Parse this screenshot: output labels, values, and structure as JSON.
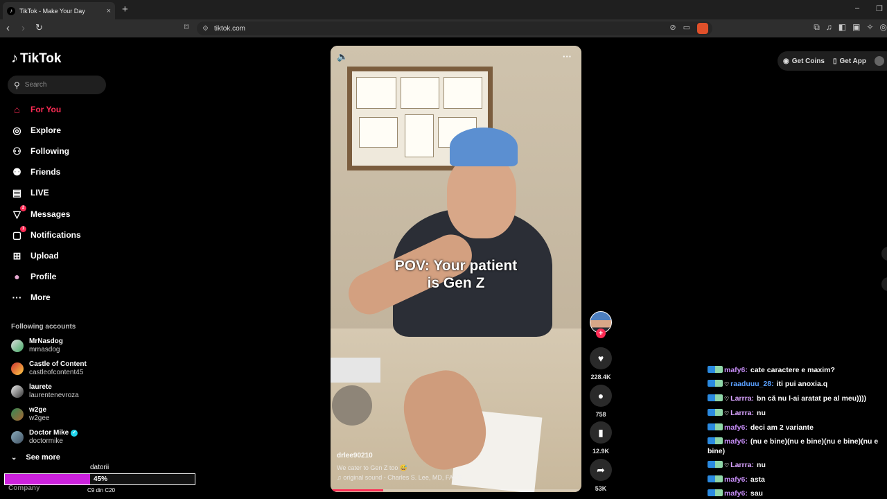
{
  "browser": {
    "tab_title": "TikTok - Make Your Day",
    "tab_close": "×",
    "new_tab": "+",
    "url": "tiktok.com",
    "window_min": "–",
    "window_max": "❐"
  },
  "sidebar": {
    "logo_text": "TikTok",
    "search_placeholder": "Search",
    "nav": [
      {
        "label": "For You",
        "icon": "home-icon"
      },
      {
        "label": "Explore",
        "icon": "compass-icon"
      },
      {
        "label": "Following",
        "icon": "following-icon"
      },
      {
        "label": "Friends",
        "icon": "friends-icon"
      },
      {
        "label": "LIVE",
        "icon": "live-icon"
      },
      {
        "label": "Messages",
        "icon": "messages-icon",
        "badge": "2"
      },
      {
        "label": "Notifications",
        "icon": "notifications-icon",
        "badge": "1"
      },
      {
        "label": "Upload",
        "icon": "upload-icon"
      },
      {
        "label": "Profile",
        "icon": "profile-icon"
      },
      {
        "label": "More",
        "icon": "more-icon"
      }
    ],
    "following_title": "Following accounts",
    "accounts": [
      {
        "name": "MrNasdog",
        "user": "mrnasdog"
      },
      {
        "name": "Castle of Content",
        "user": "castleofcontent45"
      },
      {
        "name": "laurete",
        "user": "laurentenevroza"
      },
      {
        "name": "w2ge",
        "user": "w2gee"
      },
      {
        "name": "Doctor Mike",
        "user": "doctormike",
        "verified": true
      }
    ],
    "see_more": "See more",
    "company": "Company"
  },
  "overlay": {
    "label": "datorii",
    "percent_text": "45%",
    "percent_value": 45,
    "sub": "C9 din C20",
    "fill_color": "#cc22dd"
  },
  "video": {
    "caption_line1": "POV: Your patient",
    "caption_line2": "is Gen Z",
    "author": "drlee90210",
    "description": "We cater to Gen Z too 😅",
    "sound": "♫ original sound - Charles S. Lee, MD, FACS",
    "progress": 0.21
  },
  "actions": {
    "likes": "228.4K",
    "comments": "758",
    "saves": "12.9K",
    "shares": "53K"
  },
  "topright": {
    "get_coins": "Get Coins",
    "get_app": "Get App"
  },
  "chat": [
    {
      "user": "mafy6:",
      "color": "#c58cf5",
      "msg": "cate caractere e maxim?",
      "mod": false
    },
    {
      "user": "raaduuu_28:",
      "color": "#5aa0ff",
      "msg": "iti pui anoxia.q",
      "mod": true
    },
    {
      "user": "Larrra:",
      "color": "#d9a3ff",
      "msg": "bn că nu l-ai aratat pe al meu))))",
      "mod": true
    },
    {
      "user": "Larrra:",
      "color": "#d9a3ff",
      "msg": "nu",
      "mod": true
    },
    {
      "user": "mafy6:",
      "color": "#c58cf5",
      "msg": "deci am 2 variante",
      "mod": false
    },
    {
      "user": "mafy6:",
      "color": "#c58cf5",
      "msg": "(nu e bine)(nu e bine)(nu e bine)(nu e bine)",
      "mod": false
    },
    {
      "user": "Larrra:",
      "color": "#d9a3ff",
      "msg": "nu",
      "mod": true
    },
    {
      "user": "mafy6:",
      "color": "#c58cf5",
      "msg": "asta",
      "mod": false
    },
    {
      "user": "mafy6:",
      "color": "#c58cf5",
      "msg": "sau",
      "mod": false
    }
  ],
  "colors": {
    "accent": "#fe2c55",
    "background": "#000000"
  }
}
